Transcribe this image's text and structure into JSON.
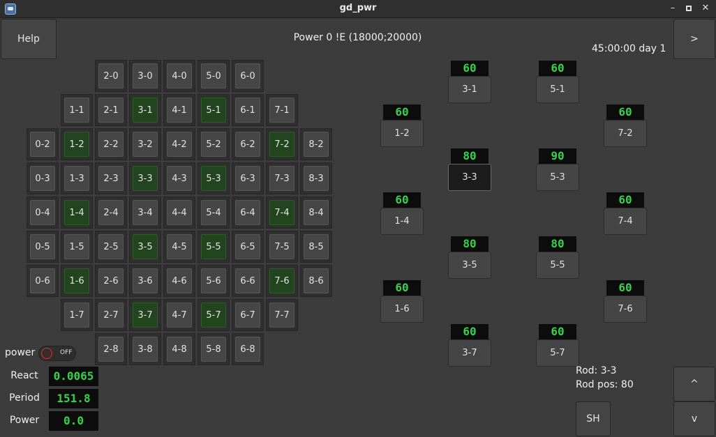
{
  "window": {
    "title": "gd_pwr",
    "minimize_glyph": "–",
    "close_glyph": "✕"
  },
  "header": {
    "help_label": "Help",
    "status": "Power 0 !E (18000;20000)",
    "time": "45:00:00 day 1",
    "next_label": ">"
  },
  "grid": {
    "rows": [
      [
        "2-0",
        "3-0",
        "4-0",
        "5-0",
        "6-0"
      ],
      [
        "1-1",
        "2-1",
        "3-1",
        "4-1",
        "5-1",
        "6-1",
        "7-1"
      ],
      [
        "0-2",
        "1-2",
        "2-2",
        "3-2",
        "4-2",
        "5-2",
        "6-2",
        "7-2",
        "8-2"
      ],
      [
        "0-3",
        "1-3",
        "2-3",
        "3-3",
        "4-3",
        "5-3",
        "6-3",
        "7-3",
        "8-3"
      ],
      [
        "0-4",
        "1-4",
        "2-4",
        "3-4",
        "4-4",
        "5-4",
        "6-4",
        "7-4",
        "8-4"
      ],
      [
        "0-5",
        "1-5",
        "2-5",
        "3-5",
        "4-5",
        "5-5",
        "6-5",
        "7-5",
        "8-5"
      ],
      [
        "0-6",
        "1-6",
        "2-6",
        "3-6",
        "4-6",
        "5-6",
        "6-6",
        "7-6",
        "8-6"
      ],
      [
        "1-7",
        "2-7",
        "3-7",
        "4-7",
        "5-7",
        "6-7",
        "7-7"
      ],
      [
        "2-8",
        "3-8",
        "4-8",
        "5-8",
        "6-8"
      ]
    ],
    "rod_cells": [
      "3-1",
      "5-1",
      "1-2",
      "7-2",
      "3-3",
      "5-3",
      "1-4",
      "7-4",
      "3-5",
      "5-5",
      "1-6",
      "7-6",
      "3-7",
      "5-7"
    ]
  },
  "rods": [
    {
      "id": "3-1",
      "value": "60"
    },
    {
      "id": "5-1",
      "value": "60"
    },
    {
      "id": "1-2",
      "value": "60"
    },
    {
      "id": "7-2",
      "value": "60"
    },
    {
      "id": "3-3",
      "value": "80"
    },
    {
      "id": "5-3",
      "value": "90"
    },
    {
      "id": "1-4",
      "value": "60"
    },
    {
      "id": "7-4",
      "value": "60"
    },
    {
      "id": "3-5",
      "value": "80"
    },
    {
      "id": "5-5",
      "value": "80"
    },
    {
      "id": "1-6",
      "value": "60"
    },
    {
      "id": "7-6",
      "value": "60"
    },
    {
      "id": "3-7",
      "value": "60"
    },
    {
      "id": "5-7",
      "value": "60"
    }
  ],
  "selected_rod": "3-3",
  "controls": {
    "power_label": "power",
    "power_toggle": "OFF",
    "react_label": "React",
    "react_value": "0.0065",
    "period_label": "Period",
    "period_value": "151.8",
    "power_value_label": "Power",
    "power_value": "0.0"
  },
  "rod_info": {
    "rod": "Rod: 3-3",
    "rod_pos": "Rod pos: 80"
  },
  "buttons": {
    "sh_label": "SH",
    "up_label": "^",
    "down_label": "v"
  }
}
